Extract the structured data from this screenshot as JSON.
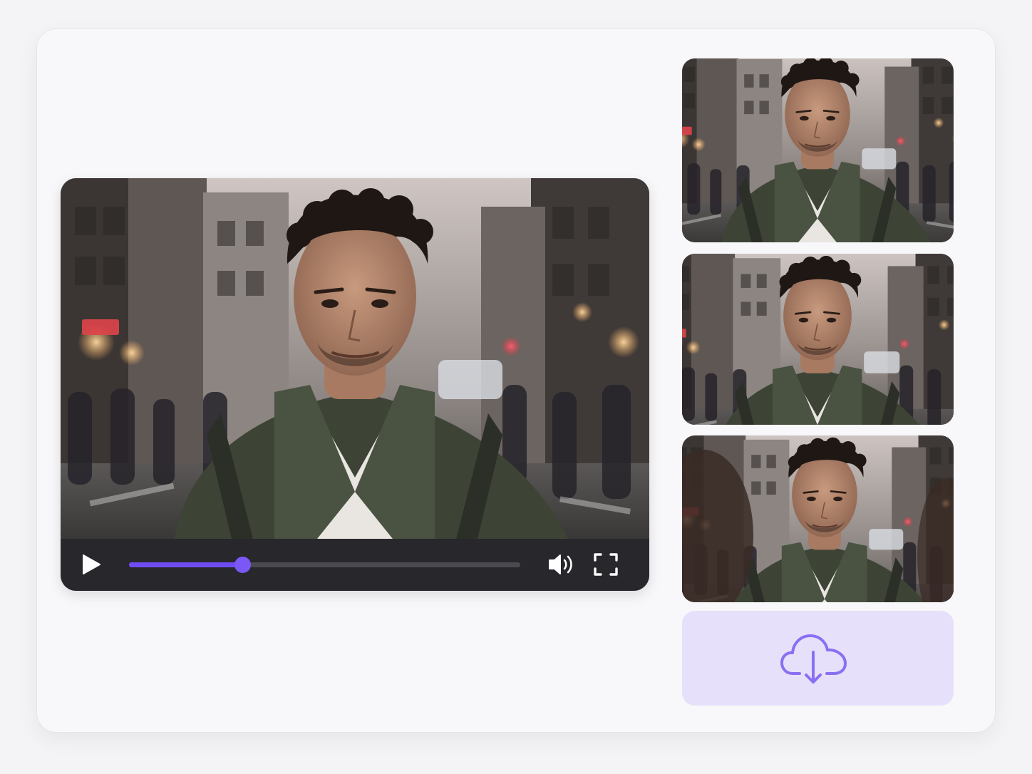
{
  "player": {
    "progress": 0.29,
    "accent_color": "#6e4cf4",
    "icons": {
      "play": "play-icon",
      "volume": "volume-icon",
      "fullscreen": "fullscreen-icon"
    }
  },
  "thumbnails": [
    {
      "expression": "looking-right"
    },
    {
      "expression": "smiling"
    },
    {
      "expression": "talking"
    }
  ],
  "download": {
    "icon": "cloud-download-icon",
    "color": "#8b6ff3",
    "background": "#e6e0fb"
  }
}
